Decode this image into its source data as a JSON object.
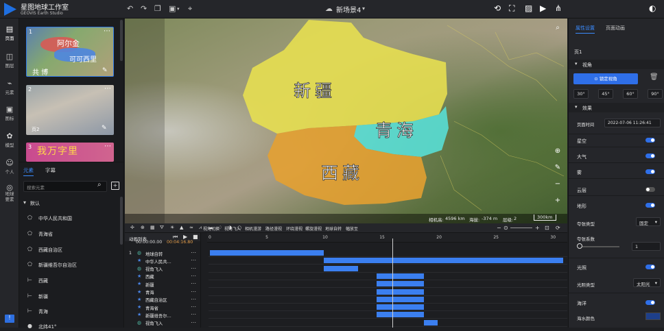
{
  "app": {
    "name": "星图地球工作室",
    "subtitle": "GEOVIS Earth Studio",
    "scene_title": "新场景4"
  },
  "left_nav": [
    {
      "label": "页面",
      "icon": "page-icon"
    },
    {
      "label": "图层",
      "icon": "layers-icon"
    },
    {
      "label": "元素",
      "icon": "element-icon"
    },
    {
      "label": "图标",
      "icon": "image-icon"
    },
    {
      "label": "模型",
      "icon": "model-icon"
    },
    {
      "label": "个人",
      "icon": "person-icon"
    },
    {
      "label": "地球要素",
      "icon": "globe-icon"
    }
  ],
  "pages": [
    {
      "num": "1",
      "label": "",
      "thumb_text": [
        "阿尔金",
        "可可西里",
        "共 博"
      ]
    },
    {
      "num": "2",
      "label": "页2",
      "thumb_text": []
    },
    {
      "num": "3",
      "label": "",
      "thumb_text": [
        "我万字里"
      ]
    }
  ],
  "element_panel": {
    "tabs": [
      "元素",
      "字幕"
    ],
    "search_placeholder": "搜索元素",
    "group": "默认",
    "items": [
      {
        "label": "中华人民共和国",
        "icon": "polygon-icon"
      },
      {
        "label": "青海省",
        "icon": "polygon-icon"
      },
      {
        "label": "西藏自治区",
        "icon": "polygon-icon"
      },
      {
        "label": "新疆维吾尔自治区",
        "icon": "polygon-icon"
      },
      {
        "label": "西藏",
        "icon": "text-icon"
      },
      {
        "label": "新疆",
        "icon": "text-icon"
      },
      {
        "label": "青海",
        "icon": "text-icon"
      },
      {
        "label": "北纬41°",
        "icon": "pin-icon"
      }
    ]
  },
  "map": {
    "labels": [
      "新疆",
      "青海",
      "西藏"
    ],
    "status": {
      "altitude_label": "相机高:",
      "altitude": "4596 km",
      "elevation_label": "海拔:",
      "elevation": "-374 m",
      "level_label": "层级:",
      "level": "2",
      "scale": "300km"
    },
    "colors": {
      "xinjiang": "#e8e050",
      "qinghai": "#58e0d8",
      "xizang": "#e6a030"
    }
  },
  "timeline": {
    "tools": [
      "视角切换",
      "视角飞入",
      "相机漫游",
      "路径漫视",
      "环绕漫视",
      "螺旋漫视",
      "地球自转",
      "幅放至"
    ],
    "list_title": "动画列表",
    "current_time": "00:00:00.00",
    "total_time": "00:04:16.80",
    "ruler_ticks": [
      "0",
      "5",
      "10",
      "15",
      "20",
      "25",
      "30"
    ],
    "playhead": 16,
    "max_time": 31,
    "rows": [
      {
        "index": "1",
        "label": "地球自转",
        "icon": "globe-icon",
        "start": 0,
        "end": 10
      },
      {
        "index": "",
        "label": "中华人民共…",
        "icon": "star-icon",
        "start": 10,
        "end": 31
      },
      {
        "index": "",
        "label": "视角飞入",
        "icon": "globe-icon",
        "start": 10,
        "end": 13
      },
      {
        "index": "",
        "label": "西藏",
        "icon": "star-icon",
        "start": 14.6,
        "end": 18.8
      },
      {
        "index": "",
        "label": "新疆",
        "icon": "star-icon",
        "start": 14.6,
        "end": 18.8
      },
      {
        "index": "",
        "label": "青海",
        "icon": "star-icon",
        "start": 14.6,
        "end": 18.8
      },
      {
        "index": "",
        "label": "西藏自治区",
        "icon": "star-icon",
        "start": 14.6,
        "end": 18.8
      },
      {
        "index": "",
        "label": "青海省",
        "icon": "star-icon",
        "start": 14.6,
        "end": 18.8
      },
      {
        "index": "",
        "label": "新疆维吾尔…",
        "icon": "star-icon",
        "start": 14.6,
        "end": 18.8
      },
      {
        "index": "",
        "label": "视角飞入",
        "icon": "globe-icon",
        "start": 18.8,
        "end": 20
      }
    ]
  },
  "props": {
    "tabs": [
      "属性设置",
      "页面动画"
    ],
    "page": "页1",
    "view_section": "视角",
    "lock_view": "锁定视角",
    "angles": [
      "30°",
      "45°",
      "60°",
      "90°"
    ],
    "effect_section": "效果",
    "page_time_label": "页面时间",
    "page_time": "2022-07-06 11:26:41",
    "toggles": [
      {
        "label": "星空",
        "on": true
      },
      {
        "label": "大气",
        "on": true
      },
      {
        "label": "雾",
        "on": true
      },
      {
        "label": "云层",
        "on": false
      },
      {
        "label": "地形",
        "on": true
      }
    ],
    "exaggeration_type_label": "夸张类型",
    "exaggeration_type": "固定",
    "exaggeration_factor_label": "夸张系数",
    "exaggeration_factor": "1",
    "light_label": "光照",
    "light_on": true,
    "light_type_label": "光照类型",
    "light_type": "太阳光",
    "ocean_label": "海洋",
    "ocean_on": true,
    "ocean_color_label": "海水颜色",
    "ocean_color": "#1e3f8a"
  }
}
